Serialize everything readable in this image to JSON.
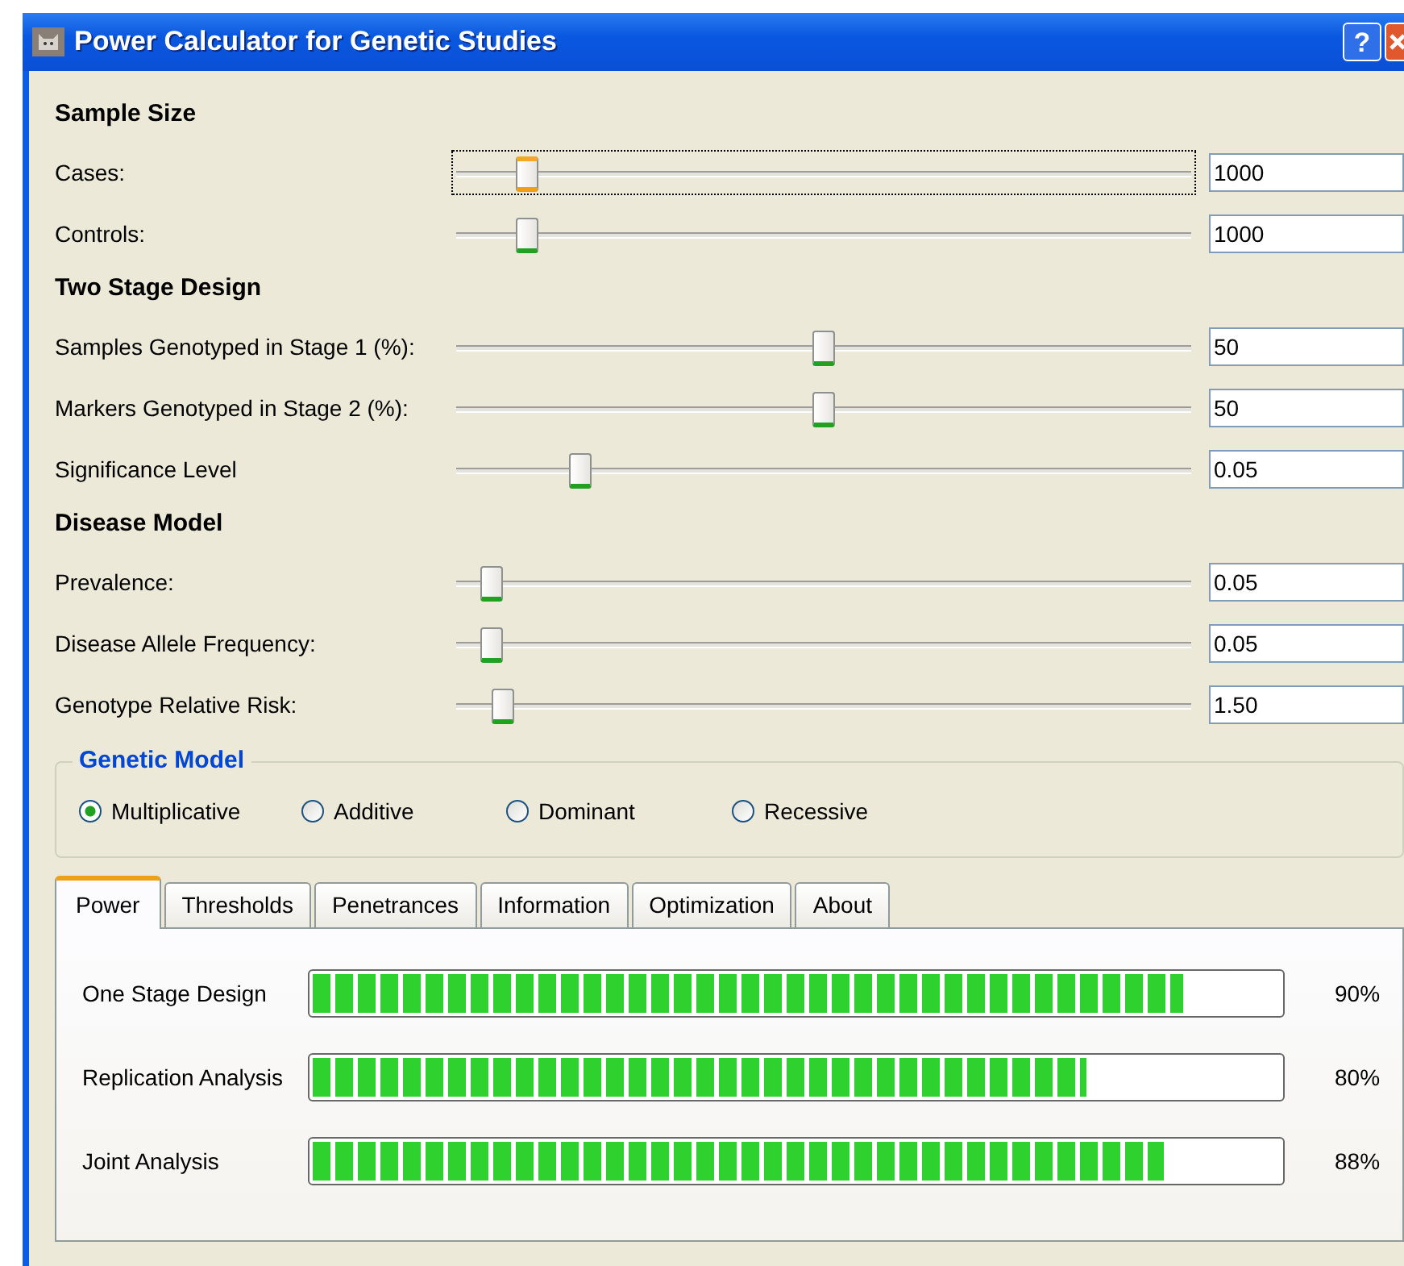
{
  "window": {
    "title": "Power Calculator for Genetic Studies",
    "help_button": "?"
  },
  "parameters": [
    {
      "kind": "heading",
      "label": "Sample Size"
    },
    {
      "kind": "slider",
      "label": "Cases:",
      "level": 0.086,
      "value": "1000",
      "focused": true
    },
    {
      "kind": "slider",
      "label": "Controls:",
      "level": 0.086,
      "value": "1000",
      "focused": false
    },
    {
      "kind": "heading",
      "label": "Two Stage Design"
    },
    {
      "kind": "slider",
      "label": "Samples Genotyped in Stage 1 (%):",
      "level": 0.5,
      "value": "50",
      "focused": false
    },
    {
      "kind": "slider",
      "label": "Markers Genotyped in Stage 2 (%):",
      "level": 0.5,
      "value": "50",
      "focused": false
    },
    {
      "kind": "slider",
      "label": "Significance Level",
      "level": 0.16,
      "value": "0.05",
      "focused": false
    },
    {
      "kind": "heading",
      "label": "Disease Model"
    },
    {
      "kind": "slider",
      "label": "Prevalence:",
      "level": 0.036,
      "value": "0.05",
      "focused": false
    },
    {
      "kind": "slider",
      "label": "Disease Allele Frequency:",
      "level": 0.036,
      "value": "0.05",
      "focused": false
    },
    {
      "kind": "slider",
      "label": "Genotype Relative Risk:",
      "level": 0.052,
      "value": "1.50",
      "focused": false
    }
  ],
  "genetic_model": {
    "title": "Genetic Model",
    "options": [
      {
        "label": "Multiplicative",
        "selected": true
      },
      {
        "label": "Additive",
        "selected": false
      },
      {
        "label": "Dominant",
        "selected": false
      },
      {
        "label": "Recessive",
        "selected": false
      }
    ]
  },
  "tabs": [
    {
      "label": "Power",
      "selected": true
    },
    {
      "label": "Thresholds",
      "selected": false
    },
    {
      "label": "Penetrances",
      "selected": false
    },
    {
      "label": "Information",
      "selected": false
    },
    {
      "label": "Optimization",
      "selected": false
    },
    {
      "label": "About",
      "selected": false
    }
  ],
  "power": [
    {
      "label": "One Stage Design",
      "level": 0.9,
      "reading": "90%"
    },
    {
      "label": "Replication Analysis",
      "level": 0.8,
      "reading": "80%"
    },
    {
      "label": "Joint Analysis",
      "level": 0.88,
      "reading": "88%"
    }
  ]
}
